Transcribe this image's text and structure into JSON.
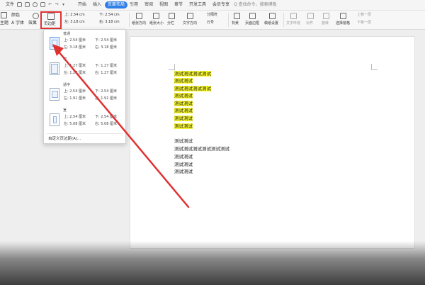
{
  "menu": {
    "items": [
      "文件",
      "开始",
      "插入",
      "页面布局",
      "引用",
      "审阅",
      "视图",
      "章节",
      "开发工具",
      "会员专享"
    ],
    "active": "页面布局",
    "search_text": "Q 查找命令、搜索模板"
  },
  "ribbon": {
    "left_labels": [
      "主题",
      "A 字体",
      "效果",
      "页边距"
    ],
    "color_label": "颜色",
    "margin_fields": {
      "top": "上: 2.54 cm",
      "bottom": "下: 2.54 cm",
      "left": "左: 3.18 cm",
      "right": "右: 3.18 cm"
    },
    "group_labels": [
      "纸张方向",
      "纸张大小",
      "分栏",
      "文字方向",
      "行号",
      "背景",
      "页面边框",
      "稿纸设置",
      "文字环绕",
      "对齐",
      "旋转",
      "选择窗格"
    ],
    "split_label": "分隔符",
    "up_label": "上移一层",
    "down_label": "下移一层"
  },
  "margins_dropdown": {
    "presets": [
      {
        "name": "普通",
        "top": "上: 2.54 厘米",
        "bottom": "下: 2.54 厘米",
        "left": "左: 3.18 厘米",
        "right": "右: 3.18 厘米"
      },
      {
        "name": "窄",
        "top": "上: 1.27 厘米",
        "bottom": "下: 1.27 厘米",
        "left": "左: 1.27 厘米",
        "right": "右: 1.27 厘米"
      },
      {
        "name": "适中",
        "top": "上: 2.54 厘米",
        "bottom": "下: 2.54 厘米",
        "left": "左: 1.91 厘米",
        "right": "右: 1.91 厘米"
      },
      {
        "name": "宽",
        "top": "上: 2.54 厘米",
        "bottom": "下: 2.54 厘米",
        "left": "左: 5.08 厘米",
        "right": "右: 5.08 厘米"
      }
    ],
    "custom_label": "自定义页边距(A)..."
  },
  "document": {
    "lines": [
      {
        "text": "测试测试测试测试",
        "highlight": true
      },
      {
        "text": "测试测试",
        "highlight": true
      },
      {
        "text": "测试测试测试测试",
        "highlight": true
      },
      {
        "text": "测试测试",
        "highlight": true
      },
      {
        "text": "测试测试",
        "highlight": true
      },
      {
        "text": "测试测试",
        "highlight": true
      },
      {
        "text": "测试测试",
        "highlight": true
      },
      {
        "text": "测试测试",
        "highlight": true
      },
      {
        "text": "测试测试",
        "highlight": false
      },
      {
        "text": "测试测试测试测试测试测试",
        "highlight": false
      },
      {
        "text": "测试测试",
        "highlight": false
      },
      {
        "text": "测试测试",
        "highlight": false
      },
      {
        "text": "测试测试",
        "highlight": false
      }
    ]
  },
  "colors": {
    "accent": "#2f7ee8",
    "highlight": "#ffff33",
    "annotation": "#e03131"
  }
}
